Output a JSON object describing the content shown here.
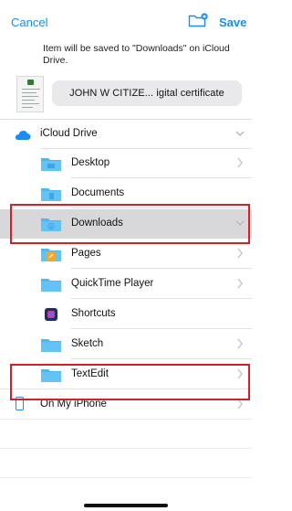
{
  "header": {
    "cancel_label": "Cancel",
    "save_label": "Save",
    "new_folder_icon": "folder-badge-plus-icon"
  },
  "save_info": "Item will be saved to \"Downloads\" on iCloud Drive.",
  "document": {
    "name": "JOHN W CITIZE... igital certificate"
  },
  "locations": {
    "icloud": {
      "label": "iCloud Drive",
      "icon": "cloud-icon",
      "folders": [
        {
          "label": "Desktop",
          "icon": "folder-icon"
        },
        {
          "label": "Documents",
          "icon": "folder-icon"
        },
        {
          "label": "Downloads",
          "icon": "folder-downloads-icon"
        },
        {
          "label": "Pages",
          "icon": "folder-pages-icon"
        },
        {
          "label": "QuickTime Player",
          "icon": "folder-icon"
        },
        {
          "label": "Shortcuts",
          "icon": "shortcuts-icon"
        },
        {
          "label": "Sketch",
          "icon": "folder-icon"
        },
        {
          "label": "TextEdit",
          "icon": "folder-icon"
        }
      ]
    },
    "on_device": {
      "label": "On My iPhone",
      "icon": "iphone-icon"
    }
  },
  "colors": {
    "accent": "#1a8df0",
    "highlight_box": "#d61f26",
    "selected_row": "#d8d8db"
  }
}
